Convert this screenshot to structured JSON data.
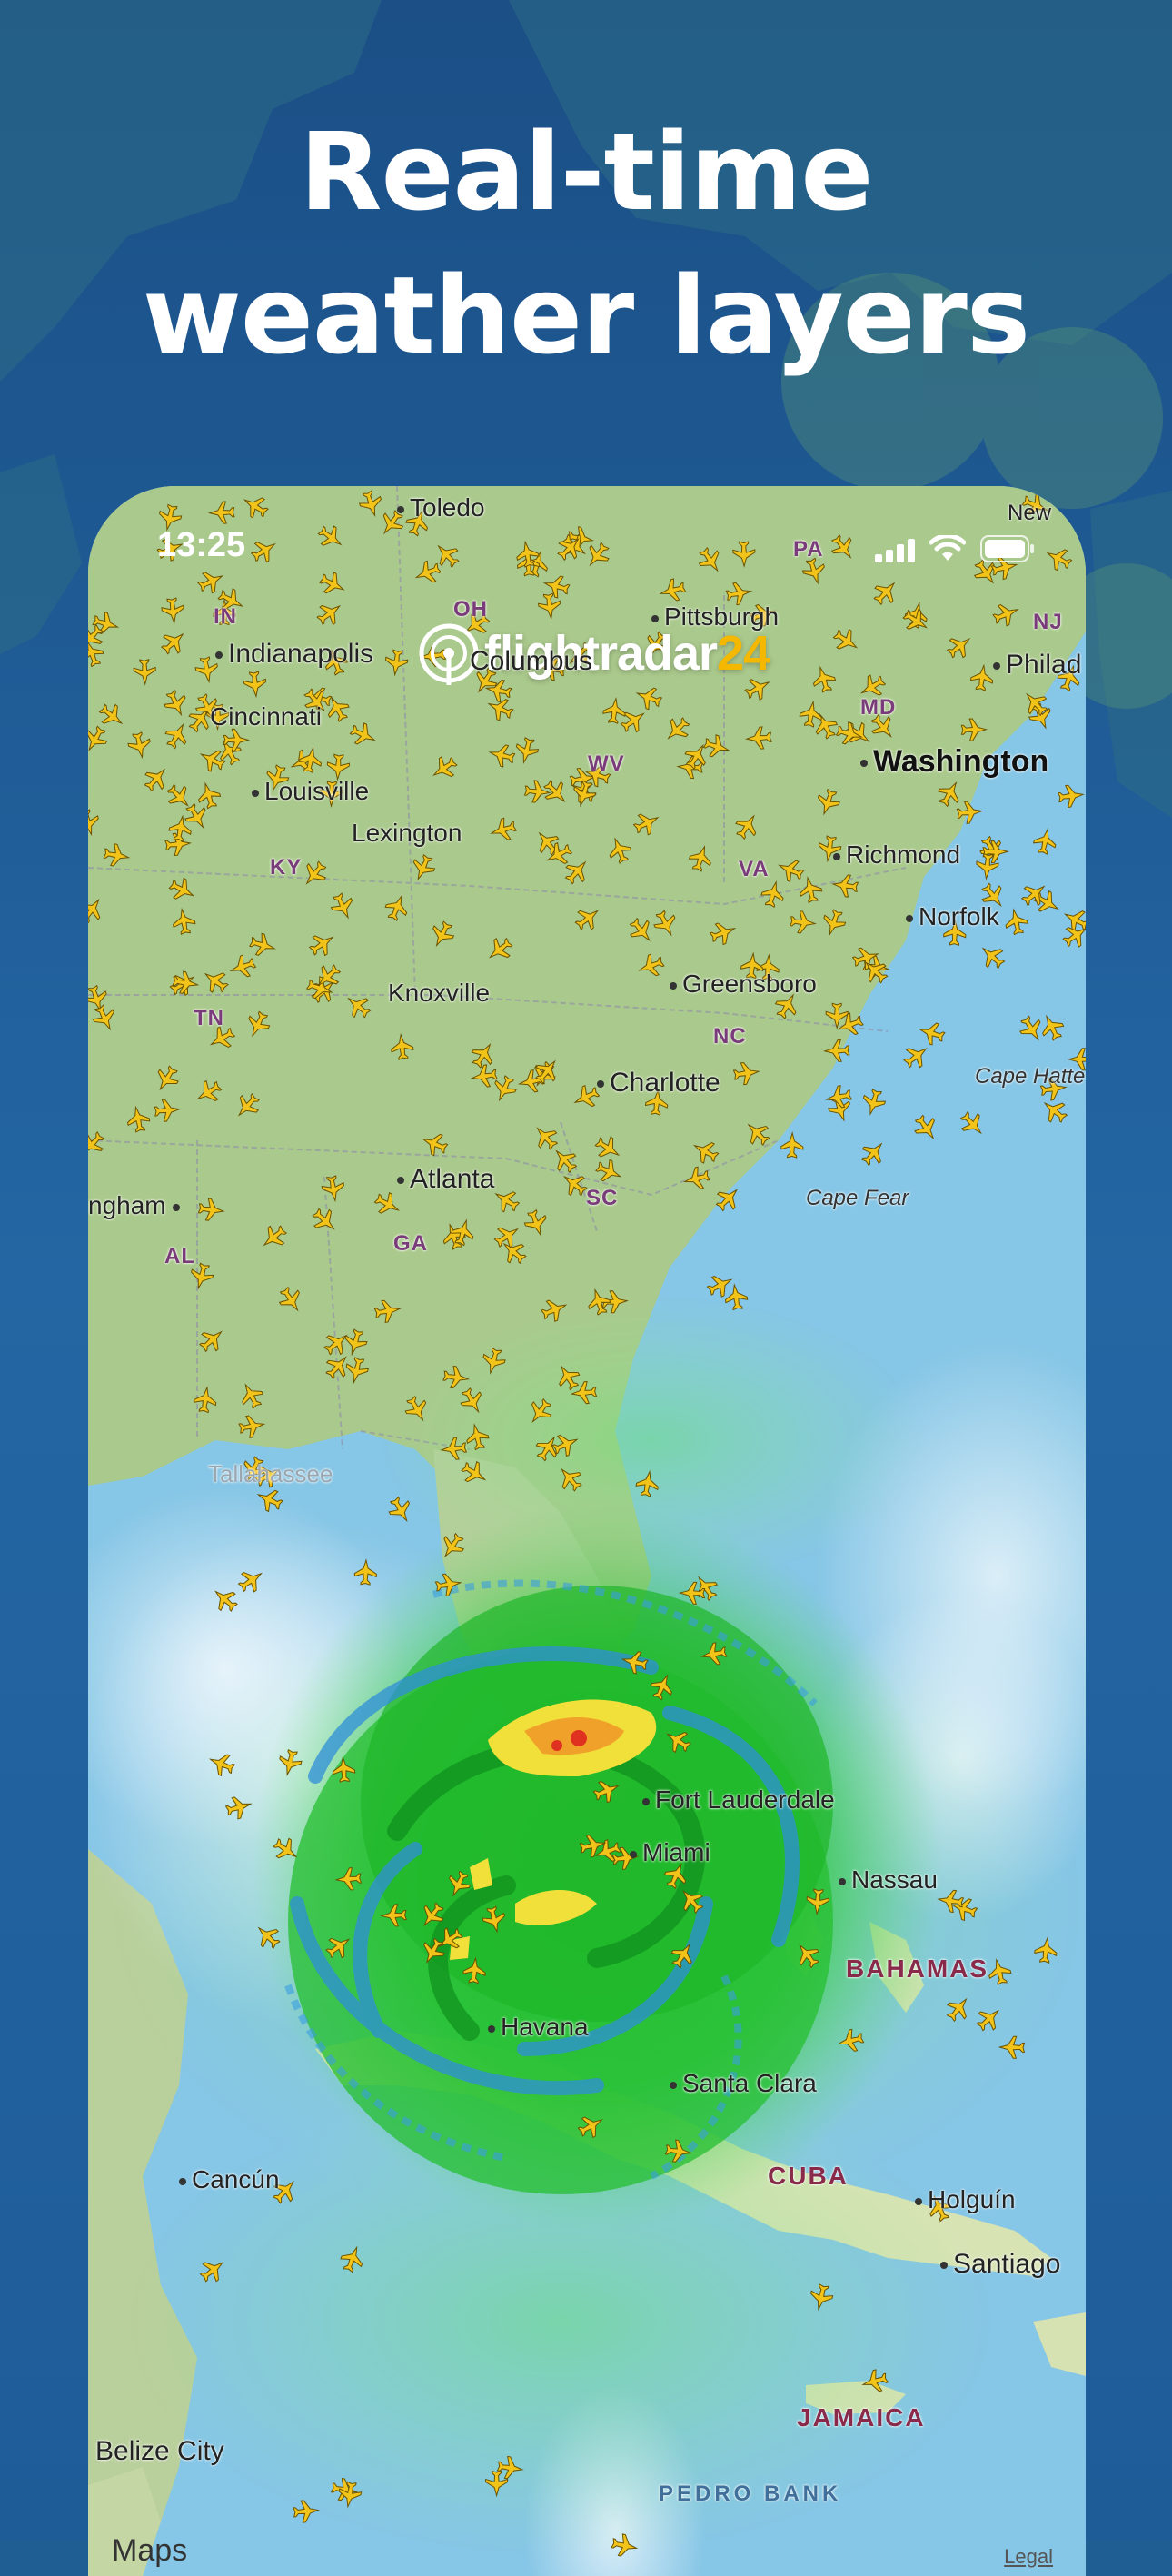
{
  "headline": {
    "line1": "Real-time",
    "line2": "weather layers"
  },
  "status_bar": {
    "time": "13:25",
    "icons": [
      "signal-icon",
      "wifi-icon",
      "battery-icon"
    ]
  },
  "app": {
    "logo_word": "flightradar",
    "logo_number": "24",
    "logo_icon": "radar-icon"
  },
  "map": {
    "labels": {
      "toledo": "Toledo",
      "new": "New",
      "pa": "PA",
      "indiana": "IN",
      "oh": "OH",
      "pittsburgh": "Pittsburgh",
      "nj": "NJ",
      "indianapolis": "Indianapolis",
      "columbus": "Columbus",
      "philad": "Philad",
      "cincinnati": "Cincinnati",
      "md": "MD",
      "wv": "WV",
      "washington": "Washington",
      "louisville": "Louisville",
      "lexington": "Lexington",
      "ky": "KY",
      "va": "VA",
      "richmond": "Richmond",
      "norfolk": "Norfolk",
      "knoxville": "Knoxville",
      "tn": "TN",
      "greensboro": "Greensboro",
      "nc": "NC",
      "cape_hatteras": "Cape Hatte",
      "charlotte": "Charlotte",
      "atlanta": "Atlanta",
      "birmingham": "ngham",
      "sc": "SC",
      "cape_fear": "Cape Fear",
      "al": "AL",
      "ga": "GA",
      "tallahassee": "Tallahassee",
      "fort_lauderdale": "Fort Lauderdale",
      "miami": "Miami",
      "nassau": "Nassau",
      "bahamas": "BAHAMAS",
      "havana": "Havana",
      "santa_clara": "Santa Clara",
      "cuba": "CUBA",
      "cancun": "Cancún",
      "holguin": "Holguín",
      "santiago": "Santiago",
      "belize_city": "Belize City",
      "jamaica": "JAMAICA",
      "pedro_bank": "PEDRO BANK"
    },
    "attribution": "Maps",
    "legal": "Legal"
  },
  "colors": {
    "background": "#1f5e93",
    "land": "#a9c98e",
    "water": "#86c6e6",
    "radar_green": "#22c22a",
    "radar_blue": "#2f8fd8",
    "radar_yellow": "#f2e03a",
    "radar_red": "#e03020",
    "plane": "#f2c41a",
    "logo_accent": "#f5b800"
  }
}
